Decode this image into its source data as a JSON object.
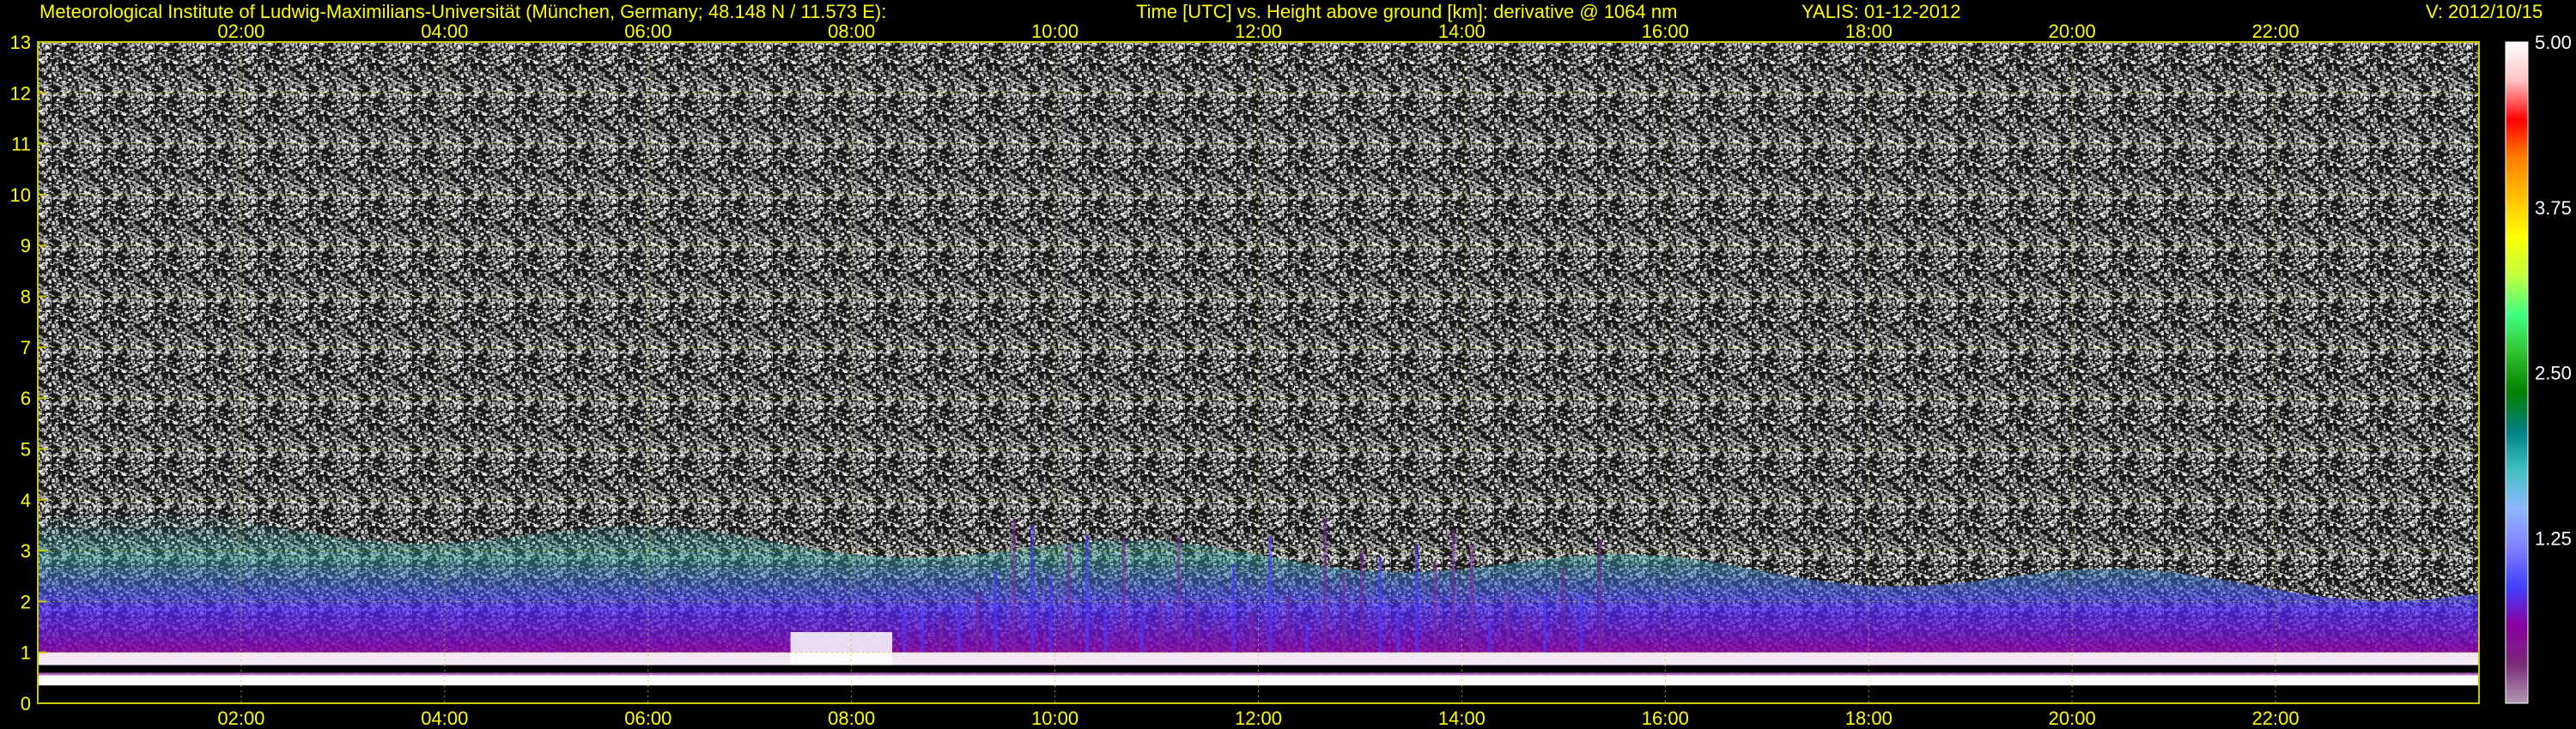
{
  "header": {
    "institute": "Meteorological Institute of Ludwig-Maximilians-Universität (München, Germany; 48.148 N / 11.573 E):",
    "axes_desc": "Time [UTC] vs. Height above ground [km]: derivative @ 1064 nm",
    "instrument": "YALIS: 01-12-2012",
    "version": "V: 2012/10/15"
  },
  "colors": {
    "background": "#000000",
    "text": "#ffff00",
    "grid": "#c8c800",
    "colorbar_label": "#ffffff"
  },
  "chart_data": {
    "type": "heatmap",
    "x_ticks": [
      "02:00",
      "04:00",
      "06:00",
      "08:00",
      "10:00",
      "12:00",
      "14:00",
      "16:00",
      "18:00",
      "20:00",
      "22:00"
    ],
    "x_tick_hours": [
      2,
      4,
      6,
      8,
      10,
      12,
      14,
      16,
      18,
      20,
      22
    ],
    "xlim_hours": [
      0,
      24
    ],
    "y_ticks": [
      "0",
      "1",
      "2",
      "3",
      "4",
      "5",
      "6",
      "7",
      "8",
      "9",
      "10",
      "11",
      "12",
      "13"
    ],
    "ylim": [
      0,
      13
    ],
    "grid": true,
    "colorbar": {
      "range": [
        0,
        5
      ],
      "tick_labels": [
        "5.00",
        "3.75",
        "2.50",
        "1.25"
      ],
      "tick_values": [
        5.0,
        3.75,
        2.5,
        1.25
      ],
      "color_stops": [
        "#b09ab0",
        "#7a2a7a",
        "#8a00a0",
        "#4040ff",
        "#8080ff",
        "#90b8ff",
        "#40c0c0",
        "#008080",
        "#008000",
        "#30c030",
        "#40ff80",
        "#c0ff40",
        "#ffff00",
        "#ffc000",
        "#ff8000",
        "#ff0000",
        "#ffc0c0",
        "#ffffff"
      ]
    },
    "features": {
      "surface_white_layer_km": [
        0.35,
        0.55
      ],
      "boundary_layer_top_km": 1.0,
      "aerosol_band_top_km_start": 3.6,
      "aerosol_band_top_km_end": 2.2,
      "bright_residual_layer_hours": [
        7.4,
        8.4
      ],
      "convective_plumes_hours": [
        8.5,
        15.5
      ]
    }
  }
}
